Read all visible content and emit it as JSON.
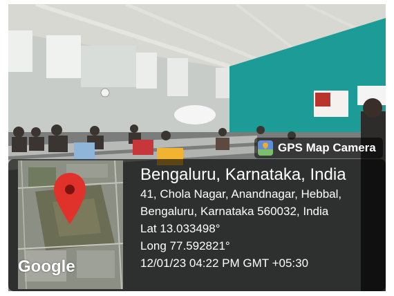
{
  "badge": {
    "label": "GPS Map Camera",
    "icon": "gps-map-camera-icon"
  },
  "location": {
    "title": "Bengaluru, Karnataka, India",
    "address_line1": "41, Chola Nagar, Anandnagar, Hebbal,",
    "address_line2": "Bengaluru, Karnataka 560032, India",
    "lat": "Lat 13.033498°",
    "long": "Long 77.592821°",
    "datetime": "12/01/23 04:22 PM GMT +05:30"
  },
  "map": {
    "logo": "Google",
    "pin_color": "#e0322b"
  },
  "colors": {
    "overlay": "#000000",
    "wall_teal": "#1d9c97",
    "text": "#ffffff"
  }
}
